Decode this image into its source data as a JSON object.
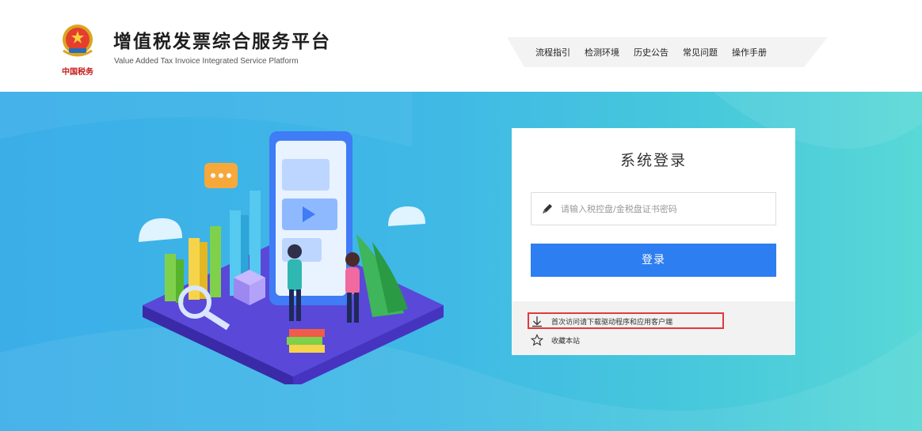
{
  "header": {
    "title_cn": "增值税发票综合服务平台",
    "title_en": "Value Added Tax Invoice Integrated Service Platform",
    "logo_caption": "中国税务",
    "nav": [
      {
        "label": "流程指引"
      },
      {
        "label": "检测环境"
      },
      {
        "label": "历史公告"
      },
      {
        "label": "常见问题"
      },
      {
        "label": "操作手册"
      }
    ]
  },
  "login": {
    "title": "系统登录",
    "password_placeholder": "请输入税控盘/金税盘证书密码",
    "password_value": "",
    "button_label": "登录",
    "links": {
      "download": "首次访问请下载驱动程序和应用客户端",
      "bookmark": "收藏本站"
    }
  },
  "colors": {
    "primary_button": "#2d7ef0",
    "hero_gradient_start": "#3baee8",
    "hero_gradient_end": "#58d8d6",
    "highlight_border": "#e03a3a"
  },
  "icons": {
    "pencil": "pencil-icon",
    "download": "download-arrow-icon",
    "bookmark": "star-outline-icon"
  }
}
